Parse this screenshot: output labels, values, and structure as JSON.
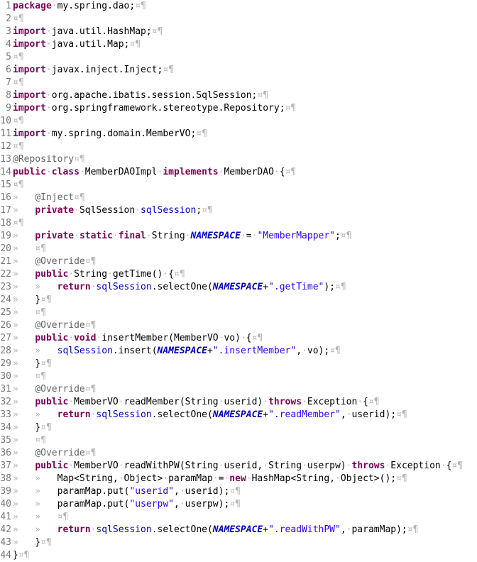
{
  "editor": {
    "colors": {
      "keyword": "#7f0055",
      "string": "#2a00ff",
      "field": "#0000c0",
      "annotation": "#646464",
      "whitespace_marker": "#b4b4b4",
      "line_number": "#787878"
    },
    "lines": [
      {
        "num": "1",
        "tokens": [
          [
            "kw",
            "package"
          ],
          [
            "ws",
            "·"
          ],
          [
            "p",
            "my.spring.dao;"
          ],
          [
            "ws",
            "¤¶"
          ]
        ]
      },
      {
        "num": "2",
        "tokens": [
          [
            "ws",
            "¤¶"
          ]
        ]
      },
      {
        "num": "3",
        "tokens": [
          [
            "kw",
            "import"
          ],
          [
            "ws",
            "·"
          ],
          [
            "p",
            "java.util.HashMap;"
          ],
          [
            "ws",
            "¤¶"
          ]
        ]
      },
      {
        "num": "4",
        "tokens": [
          [
            "kw",
            "import"
          ],
          [
            "ws",
            "·"
          ],
          [
            "p",
            "java.util.Map;"
          ],
          [
            "ws",
            "¤¶"
          ]
        ]
      },
      {
        "num": "5",
        "tokens": [
          [
            "ws",
            "¤¶"
          ]
        ]
      },
      {
        "num": "6",
        "tokens": [
          [
            "kw",
            "import"
          ],
          [
            "ws",
            "·"
          ],
          [
            "p",
            "javax.inject.Inject;"
          ],
          [
            "ws",
            "¤¶"
          ]
        ]
      },
      {
        "num": "7",
        "tokens": [
          [
            "ws",
            "¤¶"
          ]
        ]
      },
      {
        "num": "8",
        "tokens": [
          [
            "kw",
            "import"
          ],
          [
            "ws",
            "·"
          ],
          [
            "p",
            "org.apache.ibatis.session.SqlSession;"
          ],
          [
            "ws",
            "¤¶"
          ]
        ]
      },
      {
        "num": "9",
        "tokens": [
          [
            "kw",
            "import"
          ],
          [
            "ws",
            "·"
          ],
          [
            "p",
            "org.springframework.stereotype.Repository;"
          ],
          [
            "ws",
            "¤¶"
          ]
        ]
      },
      {
        "num": "10",
        "tokens": [
          [
            "ws",
            "¤¶"
          ]
        ]
      },
      {
        "num": "11",
        "tokens": [
          [
            "kw",
            "import"
          ],
          [
            "ws",
            "·"
          ],
          [
            "p",
            "my.spring.domain.MemberVO;"
          ],
          [
            "ws",
            "¤¶"
          ]
        ]
      },
      {
        "num": "12",
        "tokens": [
          [
            "ws",
            "¤¶"
          ]
        ]
      },
      {
        "num": "13",
        "tokens": [
          [
            "ann",
            "@Repository"
          ],
          [
            "ws",
            "¤¶"
          ]
        ]
      },
      {
        "num": "14",
        "tokens": [
          [
            "kw",
            "public"
          ],
          [
            "ws",
            "·"
          ],
          [
            "kw",
            "class"
          ],
          [
            "ws",
            "·"
          ],
          [
            "p",
            "MemberDAOImpl"
          ],
          [
            "ws",
            "·"
          ],
          [
            "kw",
            "implements"
          ],
          [
            "ws",
            "·"
          ],
          [
            "p",
            "MemberDAO"
          ],
          [
            "ws",
            "·"
          ],
          [
            "p",
            "{"
          ],
          [
            "ws",
            "¤¶"
          ]
        ]
      },
      {
        "num": "15",
        "tokens": [
          [
            "ws",
            "¤¶"
          ]
        ]
      },
      {
        "num": "16",
        "tokens": [
          [
            "ws",
            "»   "
          ],
          [
            "ann",
            "@Inject"
          ],
          [
            "ws",
            "¤¶"
          ]
        ]
      },
      {
        "num": "17",
        "tokens": [
          [
            "ws",
            "»   "
          ],
          [
            "kw",
            "private"
          ],
          [
            "ws",
            "·"
          ],
          [
            "p",
            "SqlSession"
          ],
          [
            "ws",
            "·"
          ],
          [
            "field",
            "sqlSession"
          ],
          [
            "p",
            ";"
          ],
          [
            "ws",
            "¤¶"
          ]
        ]
      },
      {
        "num": "18",
        "tokens": [
          [
            "ws",
            "¤¶"
          ]
        ]
      },
      {
        "num": "19",
        "tokens": [
          [
            "ws",
            "»   "
          ],
          [
            "kw",
            "private"
          ],
          [
            "ws",
            "·"
          ],
          [
            "kw",
            "static"
          ],
          [
            "ws",
            "·"
          ],
          [
            "kw",
            "final"
          ],
          [
            "ws",
            "·"
          ],
          [
            "p",
            "String"
          ],
          [
            "ws",
            "·"
          ],
          [
            "const",
            "NAMESPACE"
          ],
          [
            "ws",
            "·"
          ],
          [
            "p",
            "="
          ],
          [
            "ws",
            "·"
          ],
          [
            "str",
            "\"MemberMapper\""
          ],
          [
            "p",
            ";"
          ],
          [
            "ws",
            "¤¶"
          ]
        ]
      },
      {
        "num": "20",
        "tokens": [
          [
            "ws",
            "»   ¤¶"
          ]
        ]
      },
      {
        "num": "21",
        "tokens": [
          [
            "ws",
            "»   "
          ],
          [
            "ann",
            "@Override"
          ],
          [
            "ws",
            "¤¶"
          ]
        ]
      },
      {
        "num": "22",
        "tokens": [
          [
            "ws",
            "»   "
          ],
          [
            "kw",
            "public"
          ],
          [
            "ws",
            "·"
          ],
          [
            "p",
            "String"
          ],
          [
            "ws",
            "·"
          ],
          [
            "p",
            "getTime()"
          ],
          [
            "ws",
            "·"
          ],
          [
            "p",
            "{"
          ],
          [
            "ws",
            "¤¶"
          ]
        ]
      },
      {
        "num": "23",
        "tokens": [
          [
            "ws",
            "»   »   "
          ],
          [
            "kw",
            "return"
          ],
          [
            "ws",
            "·"
          ],
          [
            "field",
            "sqlSession"
          ],
          [
            "p",
            ".selectOne("
          ],
          [
            "const",
            "NAMESPACE"
          ],
          [
            "p",
            "+"
          ],
          [
            "str",
            "\".getTime\""
          ],
          [
            "p",
            ");"
          ],
          [
            "ws",
            "¤¶"
          ]
        ]
      },
      {
        "num": "24",
        "tokens": [
          [
            "ws",
            "»   "
          ],
          [
            "p",
            "}"
          ],
          [
            "ws",
            "¤¶"
          ]
        ]
      },
      {
        "num": "25",
        "tokens": [
          [
            "ws",
            "»   ¤¶"
          ]
        ]
      },
      {
        "num": "26",
        "tokens": [
          [
            "ws",
            "»   "
          ],
          [
            "ann",
            "@Override"
          ],
          [
            "ws",
            "¤¶"
          ]
        ]
      },
      {
        "num": "27",
        "tokens": [
          [
            "ws",
            "»   "
          ],
          [
            "kw",
            "public"
          ],
          [
            "ws",
            "·"
          ],
          [
            "kw",
            "void"
          ],
          [
            "ws",
            "·"
          ],
          [
            "p",
            "insertMember(MemberVO"
          ],
          [
            "ws",
            "·"
          ],
          [
            "p",
            "vo)"
          ],
          [
            "ws",
            "·"
          ],
          [
            "p",
            "{"
          ],
          [
            "ws",
            "¤¶"
          ]
        ]
      },
      {
        "num": "28",
        "tokens": [
          [
            "ws",
            "»   »   "
          ],
          [
            "field",
            "sqlSession"
          ],
          [
            "p",
            ".insert("
          ],
          [
            "const",
            "NAMESPACE"
          ],
          [
            "p",
            "+"
          ],
          [
            "str",
            "\".insertMember\""
          ],
          [
            "p",
            ","
          ],
          [
            "ws",
            "·"
          ],
          [
            "p",
            "vo);"
          ],
          [
            "ws",
            "¤¶"
          ]
        ]
      },
      {
        "num": "29",
        "tokens": [
          [
            "ws",
            "»   "
          ],
          [
            "p",
            "}"
          ],
          [
            "ws",
            "¤¶"
          ]
        ]
      },
      {
        "num": "30",
        "tokens": [
          [
            "ws",
            "»   ¤¶"
          ]
        ]
      },
      {
        "num": "31",
        "tokens": [
          [
            "ws",
            "»   "
          ],
          [
            "ann",
            "@Override"
          ],
          [
            "ws",
            "¤¶"
          ]
        ]
      },
      {
        "num": "32",
        "tokens": [
          [
            "ws",
            "»   "
          ],
          [
            "kw",
            "public"
          ],
          [
            "ws",
            "·"
          ],
          [
            "p",
            "MemberVO"
          ],
          [
            "ws",
            "·"
          ],
          [
            "p",
            "readMember(String"
          ],
          [
            "ws",
            "·"
          ],
          [
            "p",
            "userid)"
          ],
          [
            "ws",
            "·"
          ],
          [
            "kw",
            "throws"
          ],
          [
            "ws",
            "·"
          ],
          [
            "p",
            "Exception"
          ],
          [
            "ws",
            "·"
          ],
          [
            "p",
            "{"
          ],
          [
            "ws",
            "¤¶"
          ]
        ]
      },
      {
        "num": "33",
        "tokens": [
          [
            "ws",
            "»   »   "
          ],
          [
            "kw",
            "return"
          ],
          [
            "ws",
            "·"
          ],
          [
            "field",
            "sqlSession"
          ],
          [
            "p",
            ".selectOne("
          ],
          [
            "const",
            "NAMESPACE"
          ],
          [
            "p",
            "+"
          ],
          [
            "str",
            "\".readMember\""
          ],
          [
            "p",
            ","
          ],
          [
            "ws",
            "·"
          ],
          [
            "p",
            "userid);"
          ],
          [
            "ws",
            "¤¶"
          ]
        ]
      },
      {
        "num": "34",
        "tokens": [
          [
            "ws",
            "»   "
          ],
          [
            "p",
            "}"
          ],
          [
            "ws",
            "¤¶"
          ]
        ]
      },
      {
        "num": "35",
        "tokens": [
          [
            "ws",
            "»   ¤¶"
          ]
        ]
      },
      {
        "num": "36",
        "tokens": [
          [
            "ws",
            "»   "
          ],
          [
            "ann",
            "@Override"
          ],
          [
            "ws",
            "¤¶"
          ]
        ]
      },
      {
        "num": "37",
        "tokens": [
          [
            "ws",
            "»   "
          ],
          [
            "kw",
            "public"
          ],
          [
            "ws",
            "·"
          ],
          [
            "p",
            "MemberVO"
          ],
          [
            "ws",
            "·"
          ],
          [
            "p",
            "readWithPW(String"
          ],
          [
            "ws",
            "·"
          ],
          [
            "p",
            "userid,"
          ],
          [
            "ws",
            "·"
          ],
          [
            "p",
            "String"
          ],
          [
            "ws",
            "·"
          ],
          [
            "p",
            "userpw)"
          ],
          [
            "ws",
            "·"
          ],
          [
            "kw",
            "throws"
          ],
          [
            "ws",
            "·"
          ],
          [
            "p",
            "Exception"
          ],
          [
            "ws",
            "·"
          ],
          [
            "p",
            "{"
          ],
          [
            "ws",
            "¤¶"
          ]
        ]
      },
      {
        "num": "38",
        "tokens": [
          [
            "ws",
            "»   »   "
          ],
          [
            "p",
            "Map<String,"
          ],
          [
            "ws",
            "·"
          ],
          [
            "p",
            "Object>"
          ],
          [
            "ws",
            "·"
          ],
          [
            "p",
            "paramMap"
          ],
          [
            "ws",
            "·"
          ],
          [
            "p",
            "="
          ],
          [
            "ws",
            "·"
          ],
          [
            "kw",
            "new"
          ],
          [
            "ws",
            "·"
          ],
          [
            "p",
            "HashMap<String,"
          ],
          [
            "ws",
            "·"
          ],
          [
            "p",
            "Object>();"
          ],
          [
            "ws",
            "¤¶"
          ]
        ]
      },
      {
        "num": "39",
        "tokens": [
          [
            "ws",
            "»   »   "
          ],
          [
            "p",
            "paramMap.put("
          ],
          [
            "str",
            "\"userid\""
          ],
          [
            "p",
            ","
          ],
          [
            "ws",
            "·"
          ],
          [
            "p",
            "userid);"
          ],
          [
            "ws",
            "¤¶"
          ]
        ]
      },
      {
        "num": "40",
        "tokens": [
          [
            "ws",
            "»   »   "
          ],
          [
            "p",
            "paramMap.put("
          ],
          [
            "str",
            "\"userpw\""
          ],
          [
            "p",
            ","
          ],
          [
            "ws",
            "·"
          ],
          [
            "p",
            "userpw);"
          ],
          [
            "ws",
            "¤¶"
          ]
        ]
      },
      {
        "num": "41",
        "tokens": [
          [
            "ws",
            "»   »   ¤¶"
          ]
        ]
      },
      {
        "num": "42",
        "tokens": [
          [
            "ws",
            "»   »   "
          ],
          [
            "kw",
            "return"
          ],
          [
            "ws",
            "·"
          ],
          [
            "field",
            "sqlSession"
          ],
          [
            "p",
            ".selectOne("
          ],
          [
            "const",
            "NAMESPACE"
          ],
          [
            "p",
            "+"
          ],
          [
            "str",
            "\".readWithPW\""
          ],
          [
            "p",
            ","
          ],
          [
            "ws",
            "·"
          ],
          [
            "p",
            "paramMap);"
          ],
          [
            "ws",
            "¤¶"
          ]
        ]
      },
      {
        "num": "43",
        "tokens": [
          [
            "ws",
            "»   "
          ],
          [
            "p",
            "}"
          ],
          [
            "ws",
            "¤¶"
          ]
        ]
      },
      {
        "num": "44",
        "tokens": [
          [
            "p",
            "}"
          ],
          [
            "ws",
            "¤¶"
          ]
        ]
      }
    ]
  }
}
